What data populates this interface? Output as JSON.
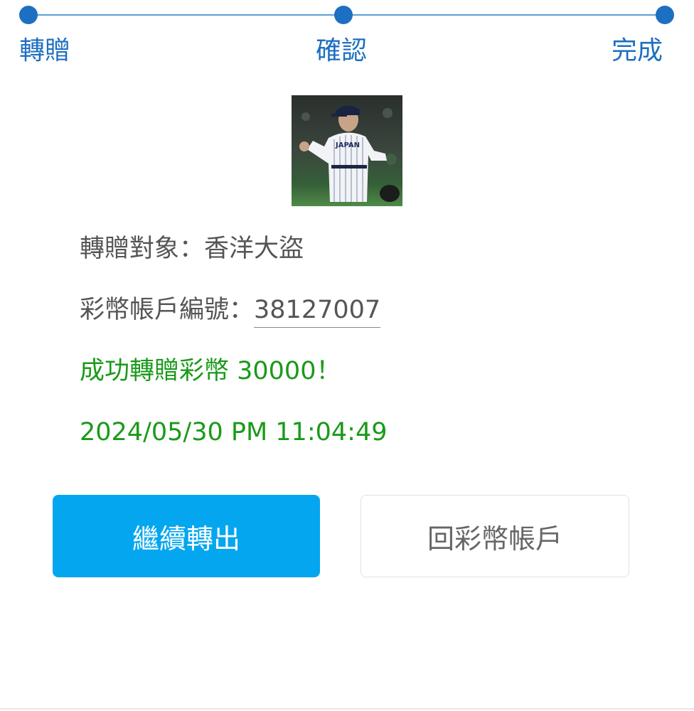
{
  "stepper": {
    "steps": [
      "轉贈",
      "確認",
      "完成"
    ],
    "color": "#1d6fc1"
  },
  "avatar": {
    "jersey_text": "JAPAN"
  },
  "transfer": {
    "recipient_label": "轉贈對象：",
    "recipient_name": "香洋大盜",
    "account_label": "彩幣帳戶編號：",
    "account_number": "38127007",
    "success_message": "成功轉贈彩幣 30000！",
    "timestamp": "2024/05/30 PM 11:04:49",
    "success_color": "#1a9a1a"
  },
  "actions": {
    "continue_label": "繼續轉出",
    "back_label": "回彩幣帳戶",
    "primary_color": "#04a7ef"
  }
}
